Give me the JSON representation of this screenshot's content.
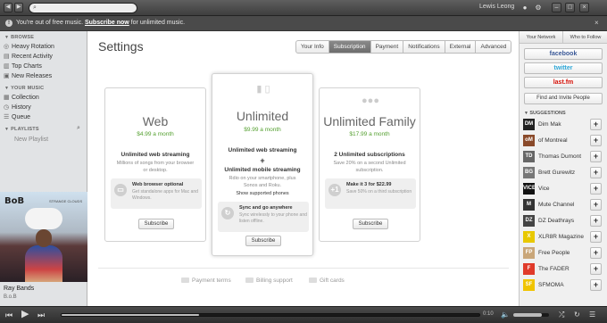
{
  "topbar": {
    "back_icon": "◀",
    "forward_icon": "▶",
    "search_placeholder": "",
    "username": "Lewis Leong",
    "win_min": "–",
    "win_max": "□",
    "win_close": "×"
  },
  "notice": {
    "prefix": "You're out of free music.",
    "link": "Subscribe now",
    "suffix": "for unlimited music."
  },
  "sidebar": {
    "browse_header": "BROWSE",
    "browse_items": [
      "Heavy Rotation",
      "Recent Activity",
      "Top Charts",
      "New Releases"
    ],
    "music_header": "YOUR MUSIC",
    "music_items": [
      "Collection",
      "History",
      "Queue"
    ],
    "playlists_header": "PLAYLISTS",
    "new_playlist": "New Playlist",
    "cover_logo": "BoB",
    "cover_title": "STRANGE CLOUDS",
    "track_title": "Ray Bands",
    "track_artist": "B.o.B"
  },
  "settings": {
    "title": "Settings",
    "tabs": [
      {
        "label": "Your Info",
        "active": false
      },
      {
        "label": "Subscription",
        "active": true
      },
      {
        "label": "Payment",
        "active": false
      },
      {
        "label": "Notifications",
        "active": false
      },
      {
        "label": "External",
        "active": false
      },
      {
        "label": "Advanced",
        "active": false
      }
    ],
    "plans": [
      {
        "name": "Web",
        "price": "$4.99 a month",
        "feature1": "Unlimited web streaming",
        "desc1": "Millions of songs from your browser or desktop.",
        "info_title": "Web browser optional",
        "info_desc": "Get standalone apps for Mac and Windows.",
        "button": "Subscribe"
      },
      {
        "name": "Unlimited",
        "price": "$9.99 a month",
        "feature1": "Unlimited web streaming",
        "plus": "+",
        "feature2": "Unlimited mobile streaming",
        "desc1": "Rdio on your smartphone, plus Sonos and Roku.",
        "desc_link": "Show supported phones",
        "info_title": "Sync and go anywhere",
        "info_desc": "Sync wirelessly to your phone and listen offline.",
        "button": "Subscribe"
      },
      {
        "name": "Unlimited Family",
        "price": "$17.99 a month",
        "feature1": "2 Unlimited subscriptions",
        "desc1": "Save 20% on a second Unlimited subscription.",
        "info_badge": "+1",
        "info_title": "Make it 3 for $22.99",
        "info_desc": "Save 50% on a third subscription",
        "button": "Subscribe"
      }
    ],
    "footer_links": [
      "Payment terms",
      "Billing support",
      "Gift cards"
    ]
  },
  "right": {
    "tab_network": "Your Network",
    "tab_follow": "Who to Follow",
    "social": [
      {
        "label": "facebook",
        "color": "#3b5998"
      },
      {
        "label": "twitter",
        "color": "#2fa8d8"
      },
      {
        "label": "last.fm",
        "color": "#d51007"
      }
    ],
    "find_invite": "Find and Invite People",
    "suggestions_header": "SUGGESTIONS",
    "suggestions": [
      {
        "name": "Dim Mak",
        "thumb": "DM",
        "color": "#222"
      },
      {
        "name": "of Montreal",
        "thumb": "oM",
        "color": "#8a4a2a"
      },
      {
        "name": "Thomas Dumont",
        "thumb": "TD",
        "color": "#666"
      },
      {
        "name": "Brett Gurewitz",
        "thumb": "BG",
        "color": "#777"
      },
      {
        "name": "Vice",
        "thumb": "VICE",
        "color": "#111"
      },
      {
        "name": "Mute Channel",
        "thumb": "M",
        "color": "#333"
      },
      {
        "name": "DZ Deathrays",
        "thumb": "DZ",
        "color": "#444"
      },
      {
        "name": "XLR8R Magazine",
        "thumb": "X",
        "color": "#e8c800"
      },
      {
        "name": "Free People",
        "thumb": "FP",
        "color": "#c9a679"
      },
      {
        "name": "The FADER",
        "thumb": "F",
        "color": "#e03a2a"
      },
      {
        "name": "SFMOMA",
        "thumb": "SF",
        "color": "#f0c400"
      }
    ]
  },
  "player": {
    "elapsed": "",
    "duration": "0:10",
    "progress": 0.33,
    "volume": 0.8
  }
}
